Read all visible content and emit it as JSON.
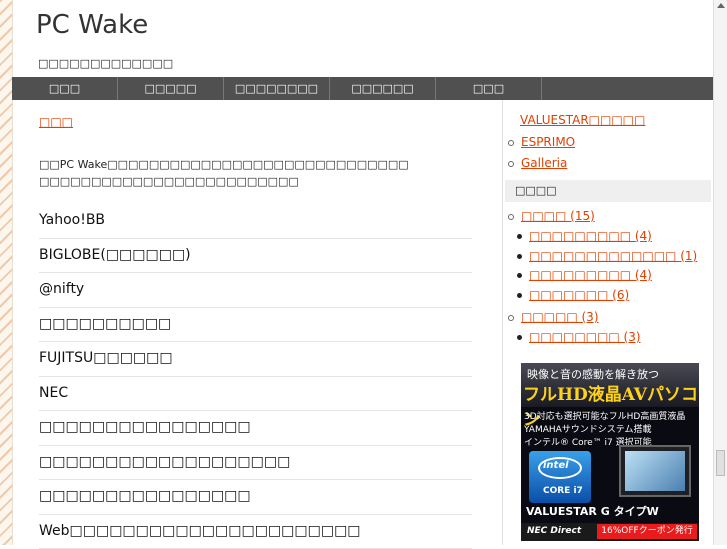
{
  "header": {
    "site_title": "PC Wake",
    "site_desc": "□□□□□□□□□□□□□"
  },
  "nav": {
    "items": [
      {
        "label": "□□□"
      },
      {
        "label": "□□□□□"
      },
      {
        "label": "□□□□□□□□"
      },
      {
        "label": "□□□□□□"
      },
      {
        "label": "□□□"
      }
    ]
  },
  "main": {
    "breadcrumb": "□□□",
    "intro_line1": "□□PC Wake□□□□□□□□□□□□□□□□□□□□□□□□□□□□□",
    "intro_line2": "□□□□□□□□□□□□□□□□□□□□□□□□□",
    "links": [
      "Yahoo!BB",
      "BIGLOBE(□□□□□□)",
      "@nifty",
      "□□□□□□□□□□",
      "FUJITSU□□□□□□",
      "NEC",
      "□□□□□□□□□□□□□□□□",
      "□□□□□□□□□□□□□□□□□□□",
      "□□□□□□□□□□□□□□□□",
      "Web□□□□□□□□□□□□□□□□□□□□□□"
    ]
  },
  "sidebar": {
    "top_links": [
      "VALUESTAR□□□□□",
      "ESPRIMO",
      "Galleria"
    ],
    "category_heading": "□□□□",
    "categories": [
      {
        "label": "□□□□ (15)",
        "children": [
          "□□□□□□□□□ (4)",
          "□□□□□□□□□□□□□ (1)",
          "□□□□□□□□□ (4)",
          "□□□□□□□ (6)"
        ]
      },
      {
        "label": "□□□□□ (3)",
        "children": [
          "□□□□□□□□ (3)"
        ]
      }
    ]
  },
  "ad": {
    "line1": "映像と音の感動を解き放つ",
    "line2": "フルHD液晶AVパソコン",
    "features": [
      "3D対応も選択可能なフルHD高画質液晶",
      "YAMAHAサウンドシステム搭載",
      "インテル® Core™ i7 選択可能"
    ],
    "chip_brand": "intel",
    "chip_model": "CORE i7",
    "product_name": "VALUESTAR G タイプW",
    "shop_brand": "NEC Direct",
    "coupon": "16%OFFクーポン発行"
  },
  "colors": {
    "link": "#e04000",
    "nav_bg": "#505050",
    "ad_yellow": "#ffd21a",
    "coupon_red": "#e81c1c"
  }
}
